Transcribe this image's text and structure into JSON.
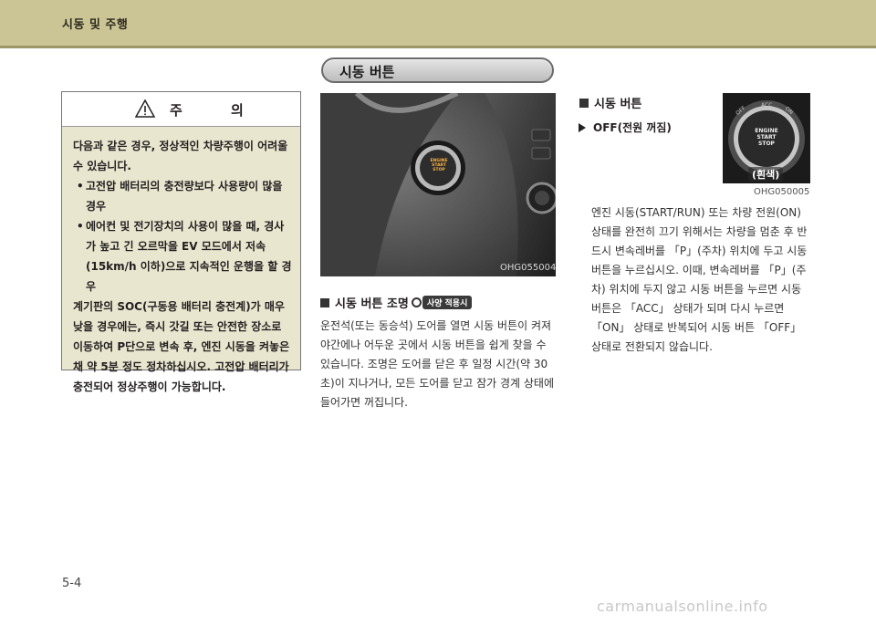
{
  "header": {
    "title": "시동 및 주행"
  },
  "section": {
    "title": "시동 버튼"
  },
  "caution": {
    "title": "주 의",
    "intro": "다음과 같은 경우, 정상적인 차량주행이 어려울 수 있습니다.",
    "bullets": [
      "고전압 배터리의 충전량보다 사용량이 많을 경우",
      "에어컨 및 전기장치의 사용이 많을 때, 경사가 높고 긴 오르막을 EV 모드에서 저속(15km/h 이하)으로 지속적인 운행을 할 경우"
    ],
    "outro": "계기판의 SOC(구동용 배터리 충전계)가 매우 낮을 경우에는, 즉시 갓길 또는 안전한 장소로 이동하여 P단으로 변속 후, 엔진 시동을 켜놓은 채 약 5분 정도 정차하십시오. 고전압 배터리가 충전되어 정상주행이 가능합니다."
  },
  "photo1": {
    "code": "OHG055004",
    "button_text": [
      "ENGINE",
      "START",
      "STOP"
    ]
  },
  "lighting": {
    "heading": "시동 버튼 조명",
    "badge": "사양 적용시",
    "text": "운전석(또는 동승석) 도어를 열면 시동 버튼이 켜져 야간에나 어두운 곳에서 시동 버튼을 쉽게 찾을 수 있습니다. 조명은 도어를 닫은 후 일정 시간(약 30초)이 지나거나, 모든 도어를 닫고 잠가 경계 상태에 들어가면 꺼집니다."
  },
  "right": {
    "heading": "시동 버튼",
    "sub": "OFF(전원 꺼짐)",
    "photo_code": "OHG050005",
    "photo_tag": "(흰색)",
    "button_text": [
      "ENGINE",
      "START",
      "STOP"
    ],
    "ring_labels": [
      "OFF",
      "ACC",
      "ON"
    ],
    "text": "엔진 시동(START/RUN) 또는 차량 전원(ON) 상태를 완전히 끄기 위해서는 차량을 멈춘 후 반드시 변속레버를 「P」(주차) 위치에 두고 시동 버튼을 누르십시오. 이때, 변속레버를 「P」(주차) 위치에 두지 않고 시동 버튼을 누르면 시동 버튼은 「ACC」 상태가 되며 다시 누르면 「ON」 상태로 반복되어 시동 버튼 「OFF」 상태로 전환되지 않습니다."
  },
  "footer": {
    "page": "5-4",
    "watermark": "carmanualsonline.info"
  },
  "colors": {
    "header": "#cbc596",
    "caution_bg": "#e9e6cf"
  }
}
